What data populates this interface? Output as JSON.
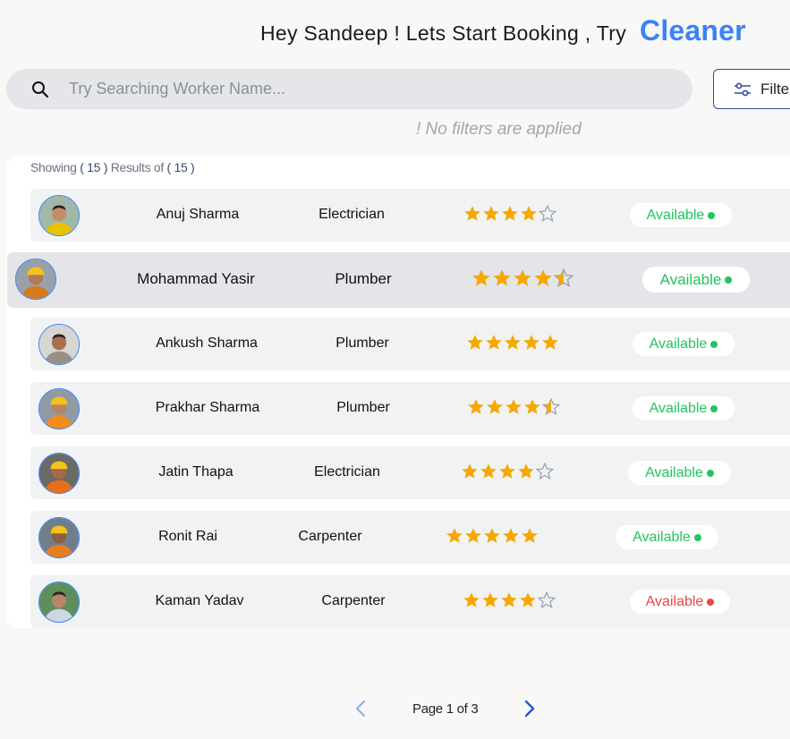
{
  "header": {
    "greeting": "Hey Sandeep ! Lets Start Booking , Try",
    "accent_word": "Cleaner",
    "accent_color": "#3b82f6"
  },
  "search": {
    "placeholder": "Try Searching Worker Name...",
    "value": "",
    "icon": "search-icon"
  },
  "filter": {
    "label": "Filter",
    "icon": "sliders-icon"
  },
  "filters_status": "! No filters are applied",
  "results": {
    "showing_label": "Showing",
    "showing_count": "( 15 )",
    "results_of_label": "Results of",
    "total_count": "( 15 )"
  },
  "workers": [
    {
      "name": "Anuj Sharma",
      "role": "Electrician",
      "rating": 4,
      "status": "Available",
      "status_color": "#22c55e"
    },
    {
      "name": "Mohammad Yasir",
      "role": "Plumber",
      "rating": 4.5,
      "status": "Available",
      "status_color": "#22c55e"
    },
    {
      "name": "Ankush Sharma",
      "role": "Plumber",
      "rating": 5,
      "status": "Available",
      "status_color": "#22c55e"
    },
    {
      "name": "Prakhar Sharma",
      "role": "Plumber",
      "rating": 4.5,
      "status": "Available",
      "status_color": "#22c55e"
    },
    {
      "name": "Jatin Thapa",
      "role": "Electrician",
      "rating": 4,
      "status": "Available",
      "status_color": "#22c55e"
    },
    {
      "name": "Ronit Rai",
      "role": "Carpenter",
      "rating": 5,
      "status": "Available",
      "status_color": "#22c55e"
    },
    {
      "name": "Kaman Yadav",
      "role": "Carpenter",
      "rating": 4,
      "status": "Available",
      "status_color": "#ef4444"
    }
  ],
  "pagination": {
    "label": "Page 1 of 3",
    "current": 1,
    "total": 3,
    "prev_icon": "chevron-left-icon",
    "next_icon": "chevron-right-icon"
  },
  "colors": {
    "star": "#f5a800",
    "star_empty": "#9ca3af",
    "accent": "#3b82f6"
  }
}
